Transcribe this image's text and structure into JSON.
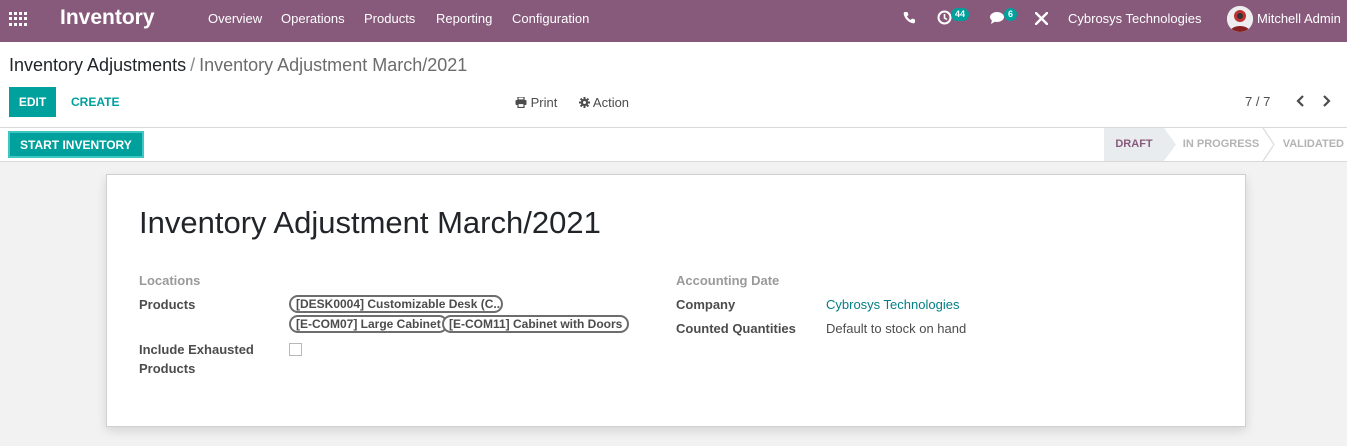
{
  "navbar": {
    "brand": "Inventory",
    "menu": [
      "Overview",
      "Operations",
      "Products",
      "Reporting",
      "Configuration"
    ],
    "activities_count": "44",
    "messages_count": "6",
    "company": "Cybrosys Technologies",
    "user": "Mitchell Admin",
    "bg_color": "#875a7b"
  },
  "breadcrumb": {
    "parent": "Inventory Adjustments",
    "separator": "/",
    "current": "Inventory Adjustment March/2021"
  },
  "buttons": {
    "edit": "EDIT",
    "create": "CREATE",
    "print": "Print",
    "action": "Action",
    "start_inventory": "START INVENTORY"
  },
  "pager": {
    "value": "7 / 7"
  },
  "statusbar": {
    "stages": [
      "DRAFT",
      "IN PROGRESS",
      "VALIDATED"
    ],
    "active": "DRAFT"
  },
  "form": {
    "title": "Inventory Adjustment March/2021",
    "locations_label": "Locations",
    "products_label": "Products",
    "products": [
      "[DESK0004] Customizable Desk (C...",
      "[E-COM07] Large Cabinet",
      "[E-COM11] Cabinet with Doors"
    ],
    "include_exhausted_label_line1": "Include Exhausted",
    "include_exhausted_label_line2": "Products",
    "include_exhausted": false,
    "accounting_date_label": "Accounting Date",
    "company_label": "Company",
    "company_value": "Cybrosys Technologies",
    "counted_quantities_label": "Counted Quantities",
    "counted_quantities_value": "Default to stock on hand"
  },
  "colors": {
    "accent": "#00a09d",
    "brand": "#875a7b",
    "link": "#017e84"
  },
  "icons": [
    "apps-grid-icon",
    "phone-icon",
    "activity-clock-icon",
    "chat-icon",
    "tools-cross-icon",
    "printer-icon",
    "gear-icon",
    "chevron-left-icon",
    "chevron-right-icon"
  ]
}
